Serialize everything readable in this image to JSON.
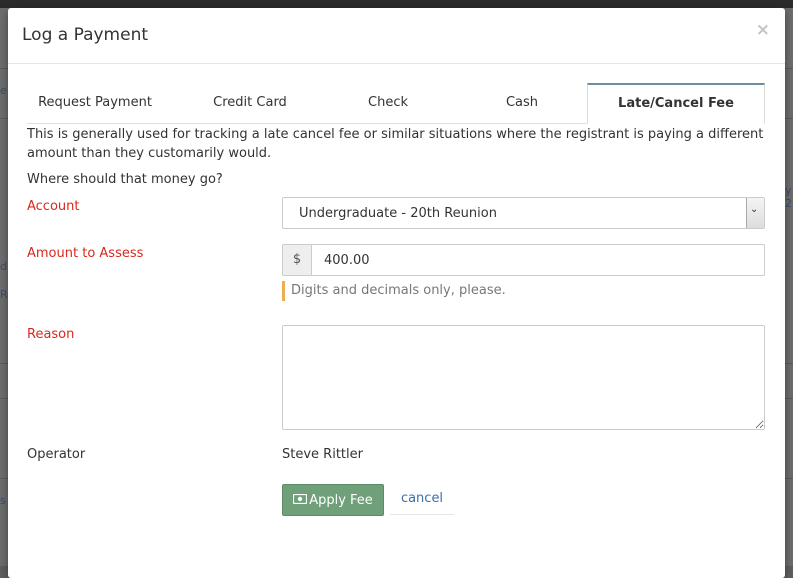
{
  "modal": {
    "title": "Log a Payment",
    "close_glyph": "×"
  },
  "tabs": [
    {
      "label": "Request Payment"
    },
    {
      "label": "Credit Card"
    },
    {
      "label": "Check"
    },
    {
      "label": "Cash"
    },
    {
      "label": "Late/Cancel Fee",
      "active": true
    }
  ],
  "description": "This is generally used for tracking a late cancel fee or similar situations where the registrant is paying a different amount than they customarily would.",
  "question": "Where should that money go?",
  "form": {
    "account_label": "Account",
    "account_value": "Undergraduate - 20th Reunion",
    "amount_label": "Amount to Assess",
    "currency_symbol": "$",
    "amount_value": "400.00",
    "amount_hint": "Digits and decimals only, please.",
    "reason_label": "Reason",
    "reason_value": "",
    "operator_label": "Operator",
    "operator_value": "Steve Rittler"
  },
  "actions": {
    "apply_label": "Apply Fee",
    "cancel_label": "cancel"
  },
  "background": {
    "fragments": [
      "e",
      "y 2",
      "d",
      "Re",
      "s"
    ]
  },
  "colors": {
    "required_label": "#d9281e",
    "apply_button": "#6fa07a",
    "hint_bar": "#f0ad4e",
    "link": "#3b6fa3"
  }
}
